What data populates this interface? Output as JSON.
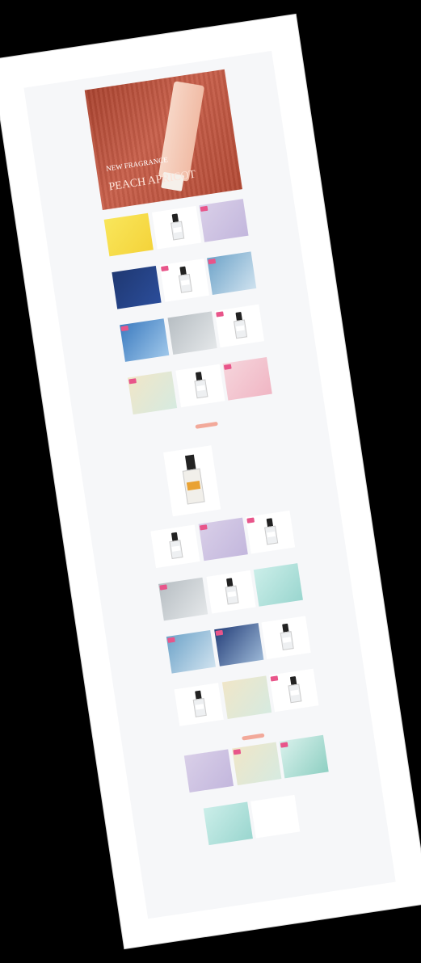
{
  "hero": {
    "line1": "NEW FRAGRANCE",
    "line2": "PEACH APRICOT"
  },
  "section1": {
    "title": ""
  },
  "section2": {
    "title": ""
  },
  "section3": {
    "title": ""
  },
  "more_label": "",
  "products_a": [
    {
      "img": "img-yellow",
      "badge": false
    },
    {
      "img": "img-white",
      "badge": false,
      "bottle": true
    },
    {
      "img": "img-purple",
      "badge": true
    },
    {
      "img": "img-navy",
      "badge": false
    },
    {
      "img": "img-white",
      "badge": true,
      "bottle": true
    },
    {
      "img": "img-sky",
      "badge": true
    },
    {
      "img": "img-blue",
      "badge": true
    },
    {
      "img": "img-grey",
      "badge": false
    },
    {
      "img": "img-white",
      "badge": true,
      "bottle": true
    },
    {
      "img": "img-pastel",
      "badge": true
    },
    {
      "img": "img-white",
      "badge": false,
      "bottle": true
    },
    {
      "img": "img-pink",
      "badge": true
    }
  ],
  "products_b": [
    {
      "img": "img-white",
      "badge": false,
      "bottle": true
    },
    {
      "img": "img-purple",
      "badge": true
    },
    {
      "img": "img-white",
      "badge": true,
      "bottle": true
    },
    {
      "img": "img-grey",
      "badge": true
    },
    {
      "img": "img-white",
      "badge": false,
      "bottle": true
    },
    {
      "img": "img-teal",
      "badge": false
    },
    {
      "img": "img-sky",
      "badge": true
    },
    {
      "img": "img-dark",
      "badge": true
    },
    {
      "img": "img-white",
      "badge": false,
      "bottle": true
    },
    {
      "img": "img-white",
      "badge": false,
      "bottle": true
    },
    {
      "img": "img-pastel",
      "badge": false
    },
    {
      "img": "img-white",
      "badge": true,
      "bottle": true
    }
  ],
  "products_c": [
    {
      "img": "img-purple",
      "badge": false
    },
    {
      "img": "img-pastel",
      "badge": true
    },
    {
      "img": "img-mint",
      "badge": true
    }
  ],
  "products_d": [
    {
      "img": "img-teal",
      "badge": false
    },
    {
      "img": "img-white",
      "badge": false
    }
  ]
}
